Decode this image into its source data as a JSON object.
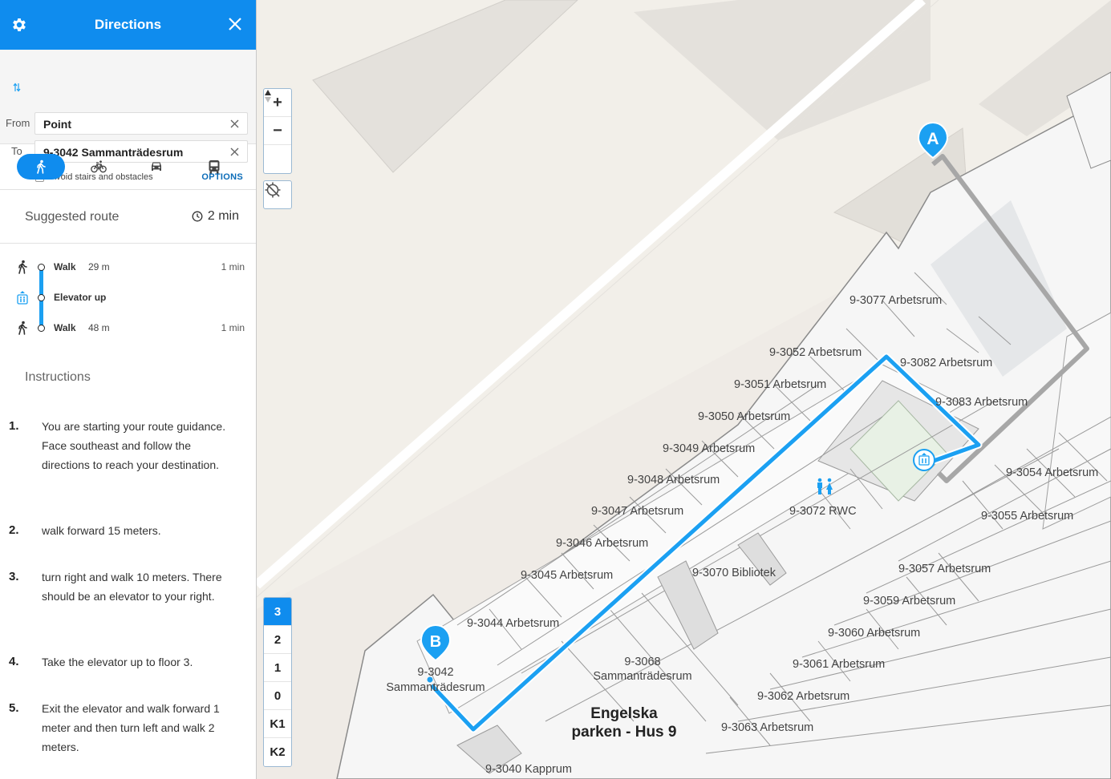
{
  "header": {
    "title": "Directions",
    "settings_icon": "gear-icon",
    "close_icon": "close-icon"
  },
  "route_form": {
    "from_label": "From",
    "to_label": "To",
    "from_value": "Point",
    "to_value": "9-3042 Sammanträdesrum",
    "avoid_label": "Avoid stairs and obstacles",
    "avoid_checked": false,
    "options_label": "OPTIONS"
  },
  "modes": [
    {
      "name": "walk",
      "icon": "walking-icon",
      "active": true
    },
    {
      "name": "bike",
      "icon": "bicycle-icon",
      "active": false
    },
    {
      "name": "car",
      "icon": "car-icon",
      "active": false
    },
    {
      "name": "transit",
      "icon": "bus-icon",
      "active": false
    }
  ],
  "suggested": {
    "label": "Suggested route",
    "duration": "2 min"
  },
  "steps": [
    {
      "icon": "walking-icon",
      "label": "Walk",
      "distance": "29 m",
      "time": "1 min"
    },
    {
      "icon": "elevator-icon",
      "label": "Elevator up",
      "distance": "",
      "time": ""
    },
    {
      "icon": "walking-icon",
      "label": "Walk",
      "distance": "48 m",
      "time": "1 min"
    }
  ],
  "instructions": {
    "title": "Instructions",
    "items": [
      {
        "num": "1.",
        "text": "You are starting your route guidance. Face southeast and follow the directions to reach your destination."
      },
      {
        "num": "2.",
        "text": "walk forward 15 meters."
      },
      {
        "num": "3.",
        "text": "turn right and walk 10 meters. There should be an elevator to your right."
      },
      {
        "num": "4.",
        "text": "Take the elevator up to floor 3."
      },
      {
        "num": "5.",
        "text": "Exit the elevator and walk forward 1 meter and then turn left and walk 2 meters."
      }
    ]
  },
  "map": {
    "zoom_in": "+",
    "zoom_out": "−",
    "compass_icon": "compass-icon",
    "locate_icon": "locate-icon",
    "floors": [
      "3",
      "2",
      "1",
      "0",
      "K1",
      "K2"
    ],
    "active_floor": "3",
    "marker_a": "A",
    "marker_b": "B",
    "building_label_1": "Engelska",
    "building_label_2": "parken - Hus 9",
    "rooms": [
      "9-3077 Arbetsrum",
      "9-3052 Arbetsrum",
      "9-3082 Arbetsrum",
      "9-3051 Arbetsrum",
      "9-3083 Arbetsrum",
      "9-3050 Arbetsrum",
      "9-3049 Arbetsrum",
      "9-3054 Arbetsrum",
      "9-3048 Arbetsrum",
      "9-3047 Arbetsrum",
      "9-3072 RWC",
      "9-3055 Arbetsrum",
      "9-3046 Arbetsrum",
      "9-3045 Arbetsrum",
      "9-3070 Bibliotek",
      "9-3057 Arbetsrum",
      "9-3059 Arbetsrum",
      "9-3044 Arbetsrum",
      "9-3060 Arbetsrum",
      "9-3068",
      "Sammanträdesrum",
      "9-3061 Arbetsrum",
      "9-3042",
      "Sammanträdesrum",
      "9-3062 Arbetsrum",
      "9-3063 Arbetsrum",
      "9-3040 Kapprum"
    ],
    "colors": {
      "route": "#1ba0f2",
      "route_done": "#a7a7a7",
      "accent": "#0f8cee"
    }
  }
}
